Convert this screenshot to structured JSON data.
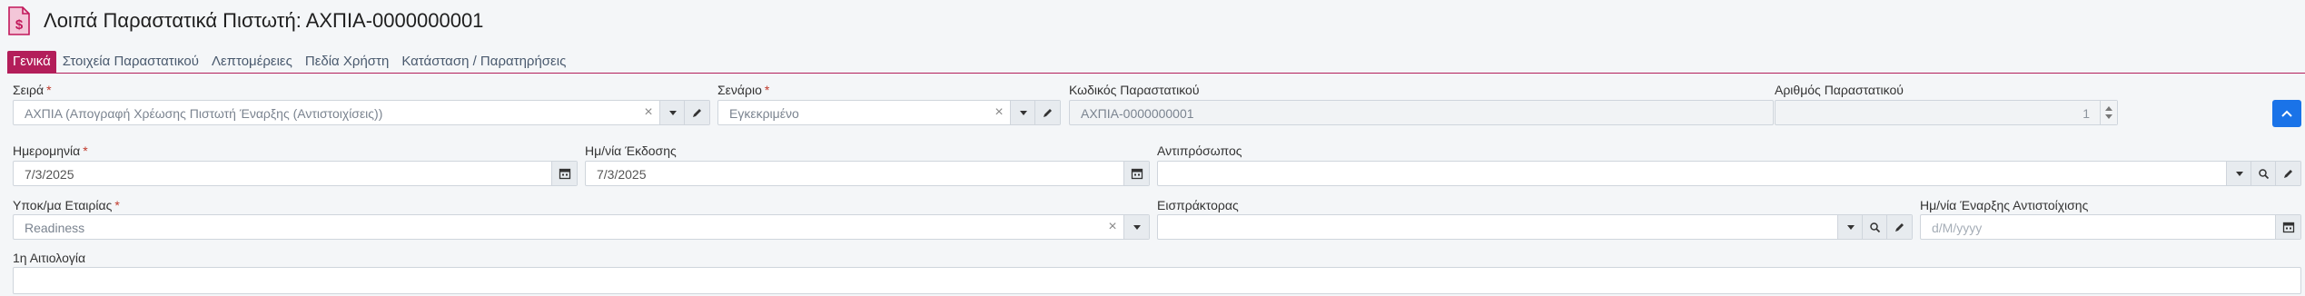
{
  "header": {
    "title": "Λοιπά Παραστατικά Πιστωτή: ΑΧΠΙΑ-0000000001",
    "doc_icon": "document-dollar-icon",
    "icon_color": "#c2185b"
  },
  "tabs": [
    {
      "label": "Γενικά",
      "active": true
    },
    {
      "label": "Στοιχεία Παραστατικού",
      "active": false
    },
    {
      "label": "Λεπτομέρειες",
      "active": false
    },
    {
      "label": "Πεδία Χρήστη",
      "active": false
    },
    {
      "label": "Κατάσταση / Παρατηρήσεις",
      "active": false
    }
  ],
  "form": {
    "series": {
      "label": "Σειρά",
      "value": "ΑΧΠΙΑ (Απογραφή Χρέωσης Πιστωτή Έναρξης (Αντιστοιχίσεις))"
    },
    "scenario": {
      "label": "Σενάριο",
      "value": "Εγκεκριμένο"
    },
    "doc_code": {
      "label": "Κωδικός Παραστατικού",
      "value": "ΑΧΠΙΑ-0000000001"
    },
    "doc_number": {
      "label": "Αριθμός Παραστατικού",
      "value": "1"
    },
    "date": {
      "label": "Ημερομηνία",
      "value": "7/3/2025"
    },
    "issue_date": {
      "label": "Ημ/νία Έκδοσης",
      "value": "7/3/2025"
    },
    "representative": {
      "label": "Αντιπρόσωπος",
      "value": ""
    },
    "branch": {
      "label": "Υποκ/μα Εταιρίας",
      "value": "Readiness"
    },
    "collector": {
      "label": "Εισπράκτορας",
      "value": ""
    },
    "matching_start": {
      "label": "Ημ/νία Έναρξης Αντιστοίχισης",
      "placeholder": "d/M/yyyy"
    },
    "reason1": {
      "label": "1η Αιτιολογία",
      "value": ""
    }
  },
  "required_marker": "*",
  "clear_glyph": "×",
  "accent_color": "#b31e5a",
  "primary_button_color": "#1a73e8"
}
